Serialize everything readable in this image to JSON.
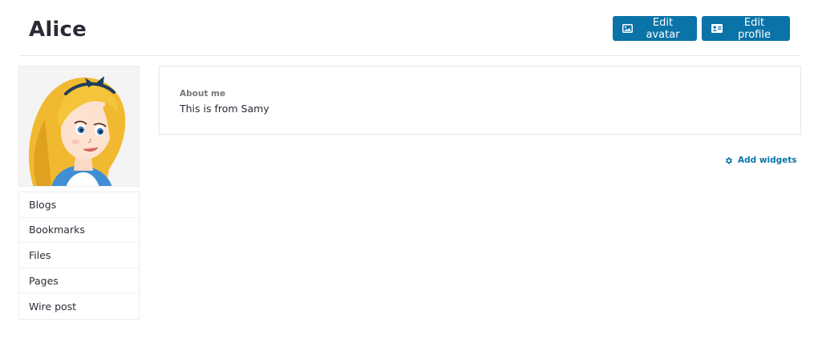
{
  "profile": {
    "name": "Alice"
  },
  "actions": {
    "edit_avatar": "Edit avatar",
    "edit_profile": "Edit profile"
  },
  "sidebar": {
    "items": [
      {
        "label": "Blogs"
      },
      {
        "label": "Bookmarks"
      },
      {
        "label": "Files"
      },
      {
        "label": "Pages"
      },
      {
        "label": "Wire post"
      }
    ]
  },
  "about": {
    "label": "About me",
    "text": "This is from Samy"
  },
  "widgets": {
    "add_label": "Add widgets"
  },
  "icons": {
    "edit_avatar": "image-icon",
    "edit_profile": "id-card-icon",
    "add_widgets": "gear-icon"
  },
  "colors": {
    "accent": "#0a73a7",
    "title": "#2b2b36",
    "muted": "#777777",
    "border": "#e6e6e6"
  }
}
